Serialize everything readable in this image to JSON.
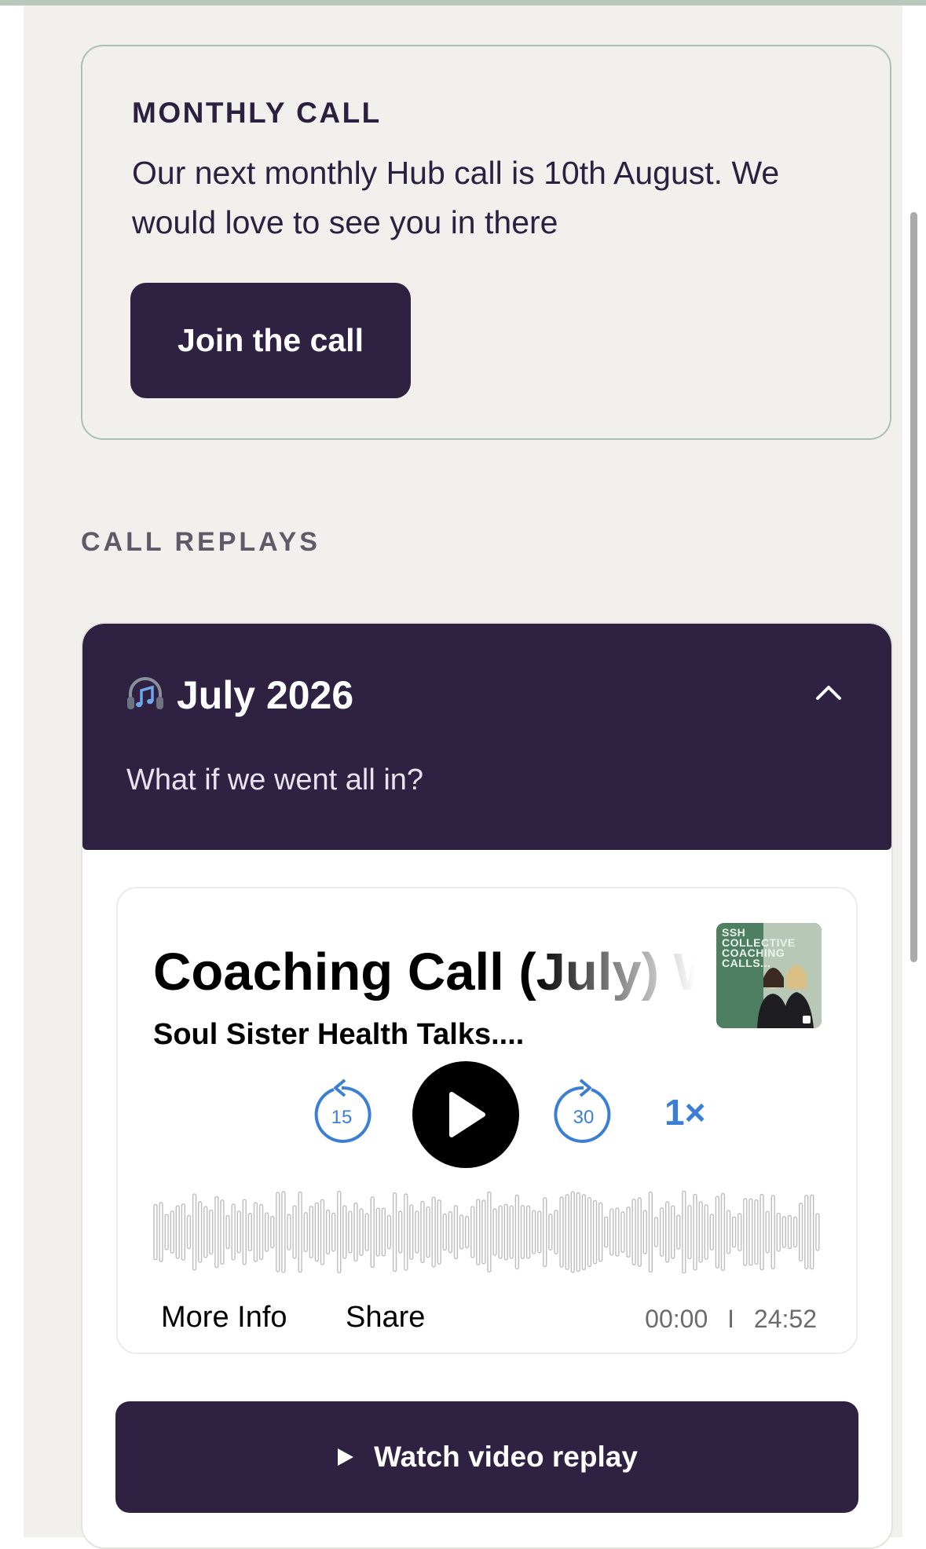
{
  "monthly_call": {
    "title": "MONTHLY CALL",
    "body": "Our next monthly Hub call is 10th August. We would love to see you in there",
    "button_label": "Join the call"
  },
  "call_replays": {
    "heading": "CALL REPLAYS",
    "items": [
      {
        "icon": "headphones-music-icon",
        "month": "July 2026",
        "description": "What if we went all in?",
        "expanded": true,
        "player": {
          "episode_title": "Coaching Call (July) W",
          "show_name": "Soul Sister Health Talks....",
          "cover_text": "SSH COLLECTIVE COACHING CALLS...",
          "rewind_seconds": "15",
          "forward_seconds": "30",
          "speed": "1×",
          "more_info_label": "More Info",
          "share_label": "Share",
          "current_time": "00:00",
          "separator": "I",
          "duration": "24:52"
        },
        "watch_button_label": "Watch video replay"
      }
    ]
  },
  "colors": {
    "brand_dark": "#2e2142",
    "background": "#f2f0ec",
    "border_sage": "#aac0b0",
    "accent_blue": "#3a7fd5"
  }
}
